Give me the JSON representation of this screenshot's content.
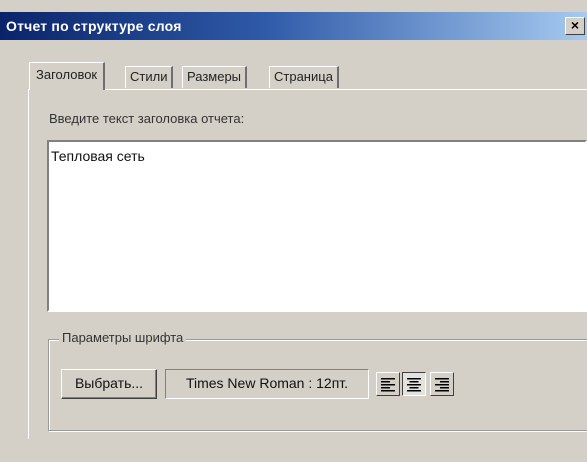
{
  "window": {
    "title": "Отчет по структуре слоя",
    "close_label": "×"
  },
  "tabs": [
    {
      "label": "Заголовок",
      "active": true
    },
    {
      "label": "Стили",
      "active": false
    },
    {
      "label": "Размеры",
      "active": false
    },
    {
      "label": "Страница",
      "active": false
    }
  ],
  "header_tab": {
    "prompt_label": "Введите текст заголовка отчета:",
    "title_value": "Тепловая сеть"
  },
  "font_group": {
    "label": "Параметры шрифта",
    "choose_button": "Выбрать...",
    "font_value": "Times New Roman : 12пт.",
    "alignment_options": [
      {
        "icon": "align-left-icon",
        "selected": false
      },
      {
        "icon": "align-center-icon",
        "selected": true
      },
      {
        "icon": "align-right-icon",
        "selected": false
      }
    ]
  },
  "colors": {
    "titlebar_start": "#0a246a",
    "titlebar_end": "#a6caf0",
    "dialog_face": "#d4d0c8"
  }
}
